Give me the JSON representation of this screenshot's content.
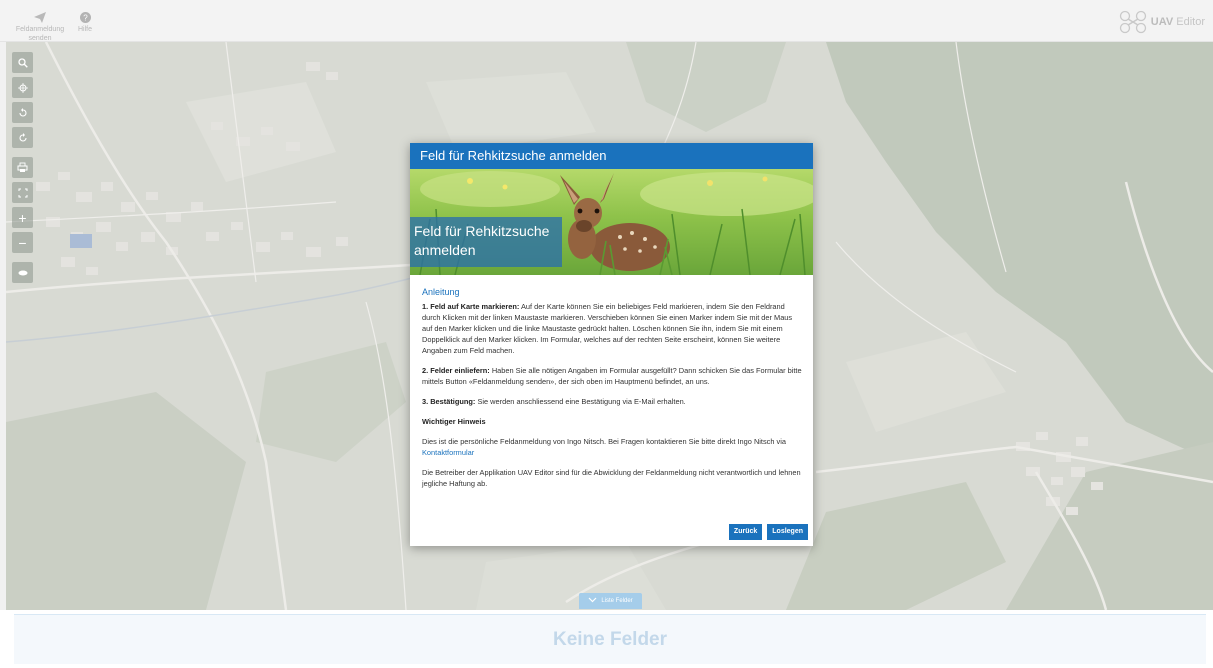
{
  "toolbar": {
    "send_label": "Feldanmeldung senden",
    "help_label": "Hilfe",
    "brand_strong": "UAV",
    "brand_rest": "Editor"
  },
  "icons": {
    "send": "paper-plane-icon",
    "help": "question-circle-icon",
    "logo": "uav-drone-icon",
    "search": "search-icon",
    "zoom_in": "plus-icon",
    "zoom_out": "minus-icon",
    "layers": "layers-icon",
    "fullscreen": "expand-icon",
    "print": "print-icon"
  },
  "map_controls": {
    "zoom_in": "+",
    "zoom_out": "−"
  },
  "dialog": {
    "title": "Feld für Rehkitzsuche anmelden",
    "hero_label": "Feld für Rehkitzsuche anmelden",
    "section_title": "Anleitung",
    "step1_title": "1. Feld auf Karte markieren:",
    "step1_text": " Auf der Karte können Sie ein beliebiges Feld markieren, indem Sie den Feldrand durch Klicken mit der linken Maustaste markieren. Verschieben können Sie einen Marker indem Sie mit der Maus auf den Marker klicken und die linke Maustaste gedrückt halten. Löschen können Sie ihn, indem Sie mit einem Doppelklick auf den Marker klicken. Im Formular, welches auf der rechten Seite erscheint, können Sie weitere Angaben zum Feld machen.",
    "step2_title": "2. Felder einliefern:",
    "step2_text": " Haben Sie alle nötigen Angaben im Formular ausgefüllt? Dann schicken Sie das Formular bitte mittels Button «Feldanmeldung senden», der sich oben im Hauptmenü befindet, an uns.",
    "step3_title": "3. Bestätigung:",
    "step3_text": " Sie werden anschliessend eine Bestätigung via E-Mail erhalten.",
    "notice_title": "Wichtiger Hinweis",
    "notice_text": "Dies ist die persönliche Feldanmeldung von Ingo Nitsch. Bei Fragen kontaktieren Sie bitte direkt Ingo Nitsch via ",
    "notice_link": "Kontaktformular",
    "disclaimer": "Die Betreiber der Applikation UAV Editor sind für die Abwicklung der Feldanmeldung nicht verantwortlich und lehnen jegliche Haftung ab.",
    "back_label": "Zurück",
    "start_label": "Loslegen"
  },
  "bottom": {
    "list_toggle": "Liste Felder",
    "empty_text": "Keine Felder"
  },
  "colors": {
    "accent": "#1a72bd",
    "toggle": "#a5cdea"
  }
}
